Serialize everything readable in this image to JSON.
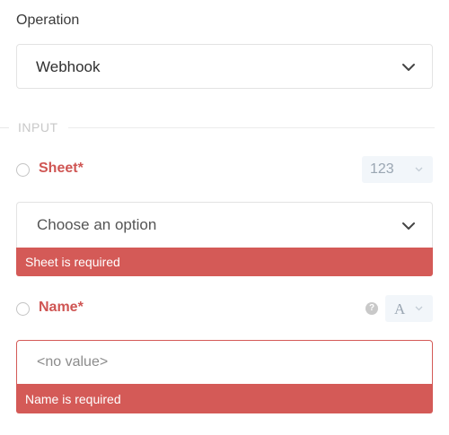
{
  "operation": {
    "label": "Operation",
    "selected": "Webhook"
  },
  "section": {
    "title": "INPUT"
  },
  "fields": [
    {
      "label": "Sheet*",
      "type_label": "123",
      "placeholder_value": "Choose an option",
      "error": "Sheet is required"
    },
    {
      "label": "Name*",
      "type_label": "A",
      "help_glyph": "?",
      "placeholder": "<no value>",
      "error": "Name is required"
    }
  ],
  "colors": {
    "error": "#d45a57",
    "label_required": "#cf5553",
    "border": "#e3e3e3",
    "type_pill_bg": "#f2f6fa"
  },
  "icons": {
    "dropdown": "chevron-down-icon",
    "radio": "radio-unchecked-icon",
    "help": "help-circle-icon"
  }
}
